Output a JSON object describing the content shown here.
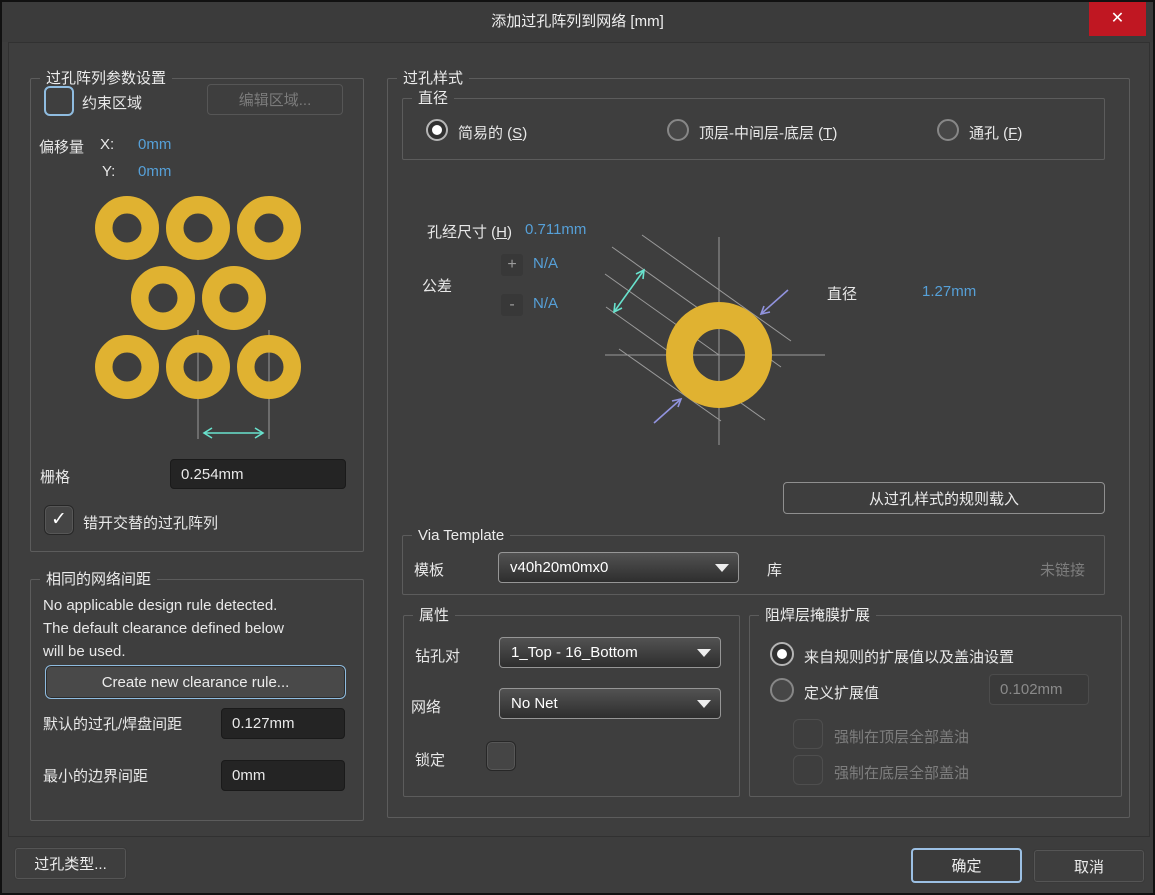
{
  "window": {
    "title": "添加过孔阵列到网络 [mm]"
  },
  "icons": {
    "close_x": "✕",
    "check": "✓"
  },
  "colors": {
    "via_gold": "#e0b231",
    "accent_blue": "#56a0d8",
    "cyan_arrow": "#68e2cd",
    "purple_arrow": "#9193de",
    "line_gray": "#9a9a9a",
    "close_red": "#c01722"
  },
  "array_settings": {
    "group_title": "过孔阵列参数设置",
    "constrain_area_label": "约束区域",
    "edit_area_button": "编辑区域...",
    "offset_label": "偏移量",
    "offset_x_label": "X:",
    "offset_x_value": "0mm",
    "offset_y_label": "Y:",
    "offset_y_value": "0mm",
    "grid_label": "栅格",
    "grid_value": "0.254mm",
    "stagger_label": "错开交替的过孔阵列"
  },
  "net_clearance": {
    "group_title": "相同的网络间距",
    "info_line1": "No applicable design rule detected.",
    "info_line2": "The default clearance defined below",
    "info_line3": "will be used.",
    "create_rule_button": "Create new clearance rule...",
    "default_clearance_label": "默认的过孔/焊盘间距",
    "default_clearance_value": "0.127mm",
    "min_boundary_label": "最小的边界间距",
    "min_boundary_value": "0mm"
  },
  "via_style": {
    "group_title": "过孔样式",
    "diameter_group_title": "直径",
    "radios": [
      {
        "prefix": "简易的 (",
        "key": "S",
        "suffix": ")",
        "selected": true
      },
      {
        "prefix": "顶层-中间层-底层 (",
        "key": "T",
        "suffix": ")",
        "selected": false
      },
      {
        "prefix": "通孔 (",
        "key": "F",
        "suffix": ")",
        "selected": false
      }
    ],
    "hole_size_prefix": "孔经尺寸 (",
    "hole_size_key": "H",
    "hole_size_suffix": ")",
    "hole_size_value": "0.711mm",
    "tolerance_label": "公差",
    "tol_plus_sign": "+",
    "tol_plus_value": "N/A",
    "tol_minus_sign": "-",
    "tol_minus_value": "N/A",
    "diameter_label": "直径",
    "diameter_value": "1.27mm",
    "load_rule_button": "从过孔样式的规则载入"
  },
  "via_template": {
    "group_title": "Via Template",
    "template_label": "模板",
    "template_value": "v40h20m0mx0",
    "library_label": "库",
    "library_status": "未链接"
  },
  "properties": {
    "group_title": "属性",
    "drill_pair_label": "钻孔对",
    "drill_pair_value": "1_Top - 16_Bottom",
    "net_label": "网络",
    "net_value": "No Net",
    "locked_label": "锁定"
  },
  "solder_mask": {
    "group_title": "阻焊层掩膜扩展",
    "from_rule_label": "来自规则的扩展值以及盖油设置",
    "define_label": "定义扩展值",
    "expansion_value": "0.102mm",
    "force_top_label": "强制在顶层全部盖油",
    "force_bottom_label": "强制在底层全部盖油"
  },
  "footer": {
    "via_types_button": "过孔类型...",
    "ok_button": "确定",
    "cancel_button": "取消"
  }
}
